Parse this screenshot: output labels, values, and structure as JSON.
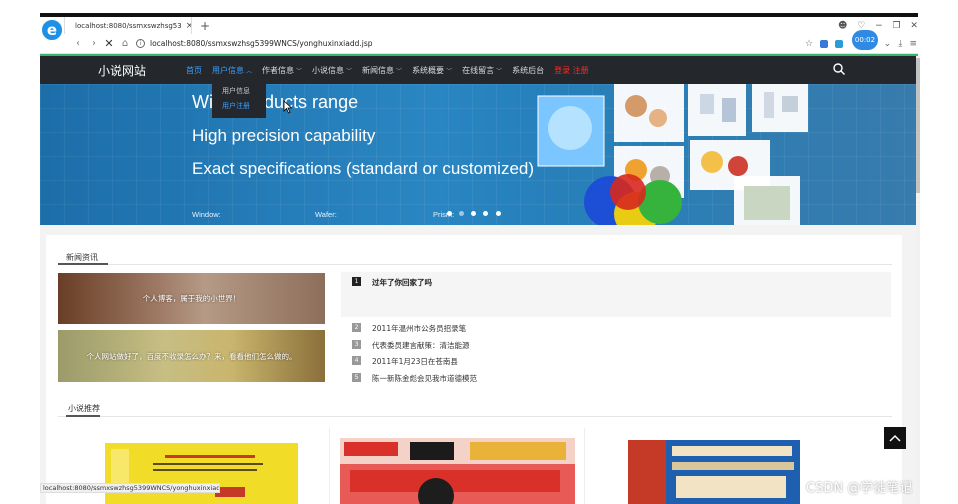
{
  "browser": {
    "tab_title": "localhost:8080/ssmxswzhsg53",
    "url": "localhost:8080/ssmxswzhsg5399WNCS/yonghuxinxiadd.jsp",
    "timer": "00:02",
    "status_url": "localhost:8080/ssmxswzhsg5399WNCS/yonghuxinxiadd.jsp#"
  },
  "site": {
    "logo": "小说网站",
    "menu": [
      {
        "label": "首页",
        "caret": false
      },
      {
        "label": "用户信息",
        "caret": true
      },
      {
        "label": "作者信息",
        "caret": true
      },
      {
        "label": "小说信息",
        "caret": true
      },
      {
        "label": "新闻信息",
        "caret": true
      },
      {
        "label": "系统概要",
        "caret": true
      },
      {
        "label": "在线留言",
        "caret": true
      },
      {
        "label": "系统后台",
        "caret": false
      },
      {
        "label": "登录 注册",
        "caret": false
      }
    ],
    "dropdown": [
      "用户信息",
      "用户注册"
    ]
  },
  "banner": {
    "line1": "Wide products range",
    "line2": "High precision capability",
    "line3": "Exact specifications (standard or customized)",
    "small": [
      "Window:",
      "Wafer:",
      "Prism:"
    ],
    "active_slide": 1,
    "slides": 5
  },
  "news": {
    "heading": "新闻资讯",
    "tiles": [
      "个人博客，属于我的小世界！",
      "个人网站做好了，百度不收录怎么办？来，看看他们怎么做的。"
    ],
    "featured": {
      "num": "1",
      "title": "过年了你回家了吗"
    },
    "items": [
      {
        "num": "2",
        "title": "2011年温州市公务员招录笔"
      },
      {
        "num": "3",
        "title": "代表委员建言献策：清洁能源"
      },
      {
        "num": "4",
        "title": "2011年1月23日在苍南县"
      },
      {
        "num": "5",
        "title": "陈一新陈金彪会见我市道德模范"
      }
    ]
  },
  "novels": {
    "heading": "小说推荐"
  },
  "watermark": "CSDN @学徒笔记"
}
